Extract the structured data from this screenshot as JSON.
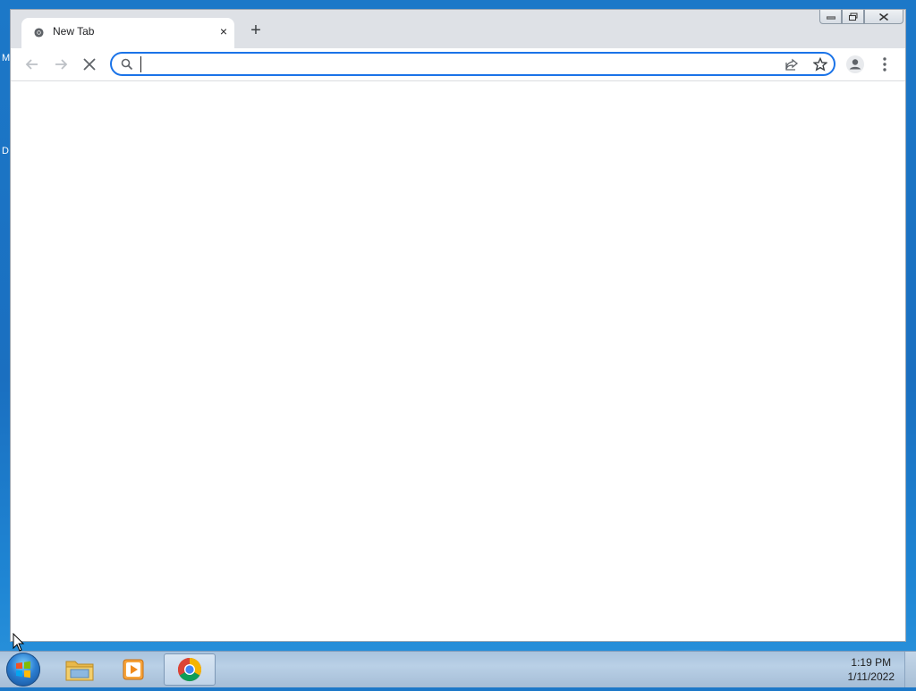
{
  "desktop": {
    "letters": [
      "M",
      "D"
    ]
  },
  "browser": {
    "tab": {
      "title": "New Tab"
    },
    "new_tab_symbol": "+",
    "close_symbol": "×",
    "omnibox": {
      "value": "",
      "placeholder": ""
    }
  },
  "taskbar": {
    "apps": [
      "file-explorer",
      "media-player",
      "chrome"
    ],
    "clock": {
      "time": "1:19 PM",
      "date": "1/11/2022"
    }
  },
  "colors": {
    "desktop": "#1c78c8",
    "omnibox_focus": "#1a73e8",
    "tab_strip": "#dee1e6"
  }
}
